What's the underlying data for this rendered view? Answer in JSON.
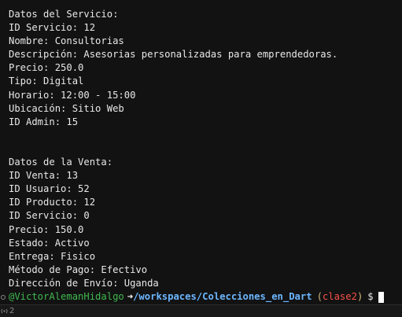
{
  "terminal": {
    "service_header": "Datos del Servicio:",
    "service_lines": [
      "ID Servicio: 12",
      "Nombre: Consultorias",
      "Descripción: Asesorias personalizadas para emprendedoras.",
      "Precio: 250.0",
      "Tipo: Digital",
      "Horario: 12:00 - 15:00",
      "Ubicación: Sitio Web",
      "ID Admin: 15"
    ],
    "sale_header": "Datos de la Venta:",
    "sale_lines": [
      "ID Venta: 13",
      "ID Usuario: 52",
      "ID Producto: 12",
      "ID Servicio: 0",
      "Precio: 150.0",
      "Estado: Activo",
      "Entrega: Fisico",
      "Método de Pago: Efectivo",
      "Dirección de Envío: Uganda"
    ],
    "prompt": {
      "user": "@VictorAlemanHidalgo",
      "arrow": "➜",
      "path": "/workspaces/Colecciones_en_Dart",
      "open_paren": "(",
      "branch": "clase2",
      "close_paren": ")",
      "symbol": "$"
    }
  },
  "statusbar": {
    "ports_count": "2",
    "ports_icon": "antenna-icon"
  },
  "colors": {
    "background": "#121212",
    "user": "#3fb950",
    "path": "#6cb6ff",
    "branch": "#f85149",
    "paren": "#d7ba7d"
  }
}
